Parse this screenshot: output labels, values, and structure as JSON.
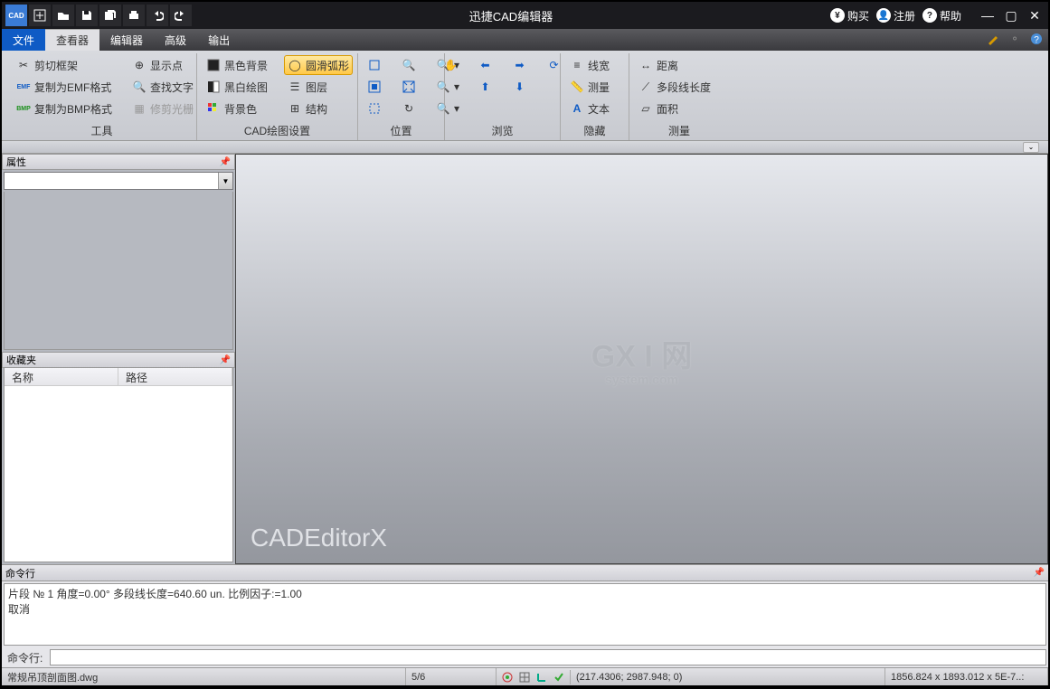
{
  "title": "迅捷CAD编辑器",
  "titlebar_links": {
    "buy": "购买",
    "register": "注册",
    "help": "帮助"
  },
  "menu": {
    "file": "文件",
    "viewer": "查看器",
    "editor": "编辑器",
    "advanced": "高级",
    "output": "输出"
  },
  "ribbon": {
    "tools": {
      "clip_frame": "剪切框架",
      "copy_emf": "复制为EMF格式",
      "copy_bmp": "复制为BMP格式",
      "show_point": "显示点",
      "find_text": "查找文字",
      "trim_raster": "修剪光栅",
      "label": "工具"
    },
    "cad_settings": {
      "black_bg": "黑色背景",
      "bw_draw": "黑白绘图",
      "bg_color": "背景色",
      "smooth_arc": "圆滑弧形",
      "layer": "图层",
      "structure": "结构",
      "label": "CAD绘图设置"
    },
    "position": {
      "label": "位置"
    },
    "browse": {
      "label": "浏览"
    },
    "hide": {
      "linewidth": "线宽",
      "measure": "测量",
      "text": "文本",
      "label": "隐藏"
    },
    "measure": {
      "distance": "距离",
      "polyline_length": "多段线长度",
      "area": "面积",
      "label": "测量"
    }
  },
  "side": {
    "properties": "属性",
    "favorites": "收藏夹",
    "fav_cols": {
      "name": "名称",
      "path": "路径"
    }
  },
  "canvas": {
    "watermark_main": "GX I 网",
    "watermark_sub": "system.com",
    "brand": "CADEditorX"
  },
  "cmd": {
    "title": "命令行",
    "log_line1": "片段 № 1 角度=0.00° 多段线长度=640.60 un. 比例因子:=1.00",
    "log_line2": "取消",
    "prompt": "命令行:"
  },
  "status": {
    "file": "常规吊顶剖面图.dwg",
    "page": "5/6",
    "coords": "(217.4306; 2987.948; 0)",
    "dims": "1856.824 x 1893.012 x 5E-7..:"
  }
}
